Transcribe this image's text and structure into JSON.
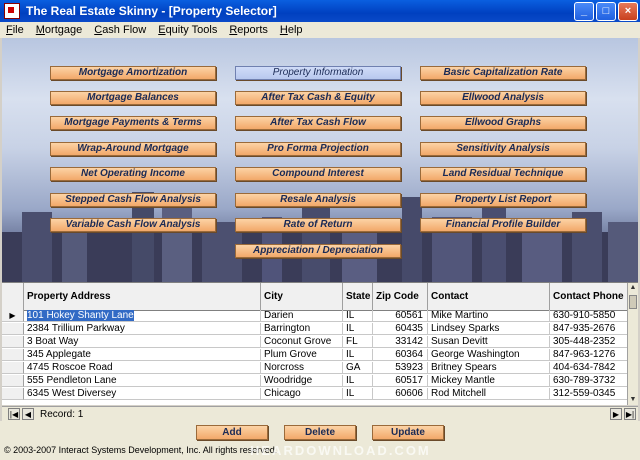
{
  "window": {
    "title": "The Real Estate Skinny - [Property Selector]"
  },
  "menu": [
    "File",
    "Mortgage",
    "Cash Flow",
    "Equity Tools",
    "Reports",
    "Help"
  ],
  "buttons": {
    "col1": [
      "Mortgage Amortization",
      "Mortgage Balances",
      "Mortgage Payments & Terms",
      "Wrap-Around Mortgage",
      "Net Operating Income",
      "Stepped Cash Flow Analysis",
      "Variable Cash Flow Analysis"
    ],
    "col2": [
      "Property Information",
      "After Tax Cash & Equity",
      "After Tax Cash Flow",
      "Pro Forma Projection",
      "Compound Interest",
      "Resale Analysis",
      "Rate of Return",
      "Appreciation / Depreciation"
    ],
    "col3": [
      "Basic Capitalization Rate",
      "Ellwood Analysis",
      "Ellwood Graphs",
      "Sensitivity Analysis",
      "Land Residual Technique",
      "Property List Report",
      "Financial Profile Builder"
    ]
  },
  "table": {
    "headers": [
      "Property Address",
      "City",
      "State",
      "Zip Code",
      "Contact",
      "Contact Phone"
    ],
    "rows": [
      [
        "101 Hokey Shanty Lane",
        "Darien",
        "IL",
        "60561",
        "Mike Martino",
        "630-910-5850"
      ],
      [
        "2384 Trillium Parkway",
        "Barrington",
        "IL",
        "60435",
        "Lindsey Sparks",
        "847-935-2676"
      ],
      [
        "3 Boat Way",
        "Coconut Grove",
        "FL",
        "33142",
        "Susan Devitt",
        "305-448-2352"
      ],
      [
        "345 Applegate",
        "Plum Grove",
        "IL",
        "60364",
        "George Washington",
        "847-963-1276"
      ],
      [
        "4745 Roscoe Road",
        "Norcross",
        "GA",
        "53923",
        "Britney Spears",
        "404-634-7842"
      ],
      [
        "555 Pendleton Lane",
        "Woodridge",
        "IL",
        "60517",
        "Mickey Mantle",
        "630-789-3732"
      ],
      [
        "6345 West Diversey",
        "Chicago",
        "IL",
        "60606",
        "Rod Mitchell",
        "312-559-0345"
      ]
    ]
  },
  "navigator": {
    "record_text": "Record: 1"
  },
  "actions": {
    "add": "Add",
    "delete": "Delete",
    "update": "Update"
  },
  "footer": {
    "copyright": "© 2003-2007 Interact Systems Development, Inc.  All rights reserved."
  },
  "watermark": "HEARDOWNLOAD.COM"
}
